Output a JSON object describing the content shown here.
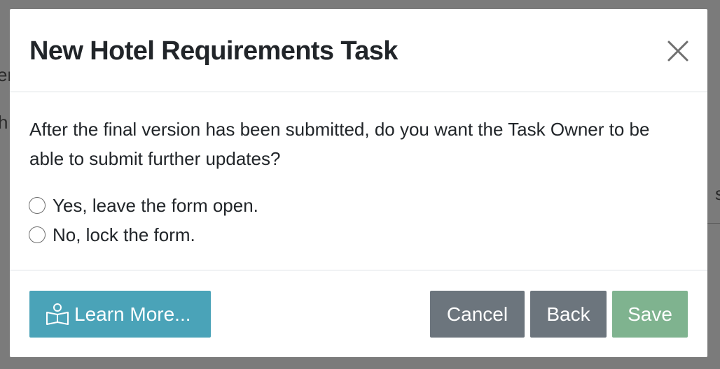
{
  "background": {
    "fragments": [
      "er",
      "h",
      "s"
    ]
  },
  "dialog": {
    "title": "New Hotel Requirements Task",
    "question": "After the final version has been submitted, do you want the Task Owner to be able to submit further updates?",
    "options": [
      {
        "label": "Yes, leave the form open.",
        "selected": false
      },
      {
        "label": "No, lock the form.",
        "selected": false
      }
    ],
    "buttons": {
      "learn_more": "Learn More...",
      "cancel": "Cancel",
      "back": "Back",
      "save": "Save"
    },
    "icons": {
      "close": "close-icon",
      "learn_more": "book-reader-icon"
    },
    "colors": {
      "learn_more_bg": "#4aa3b8",
      "secondary_bg": "#6c757d",
      "save_bg": "#7fb38f"
    }
  }
}
